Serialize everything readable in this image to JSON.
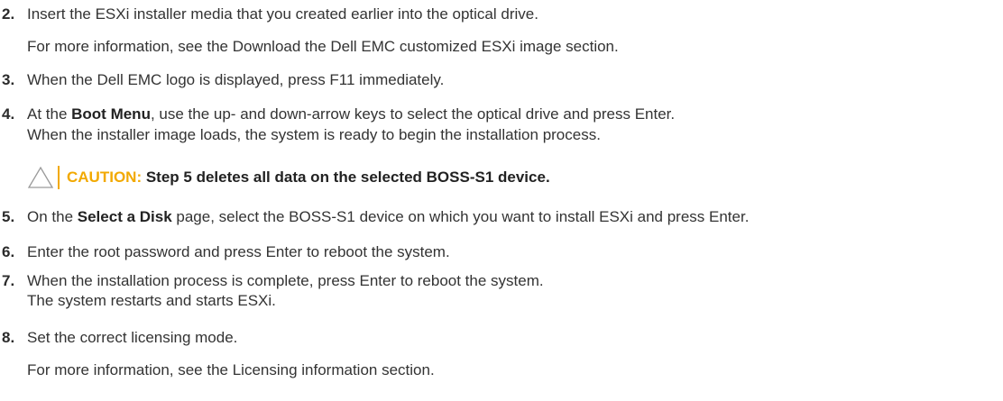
{
  "steps": [
    {
      "number": "2.",
      "lines": [
        "Insert the ESXi installer media that you created earlier into the optical drive.",
        "For more information, see the Download the Dell EMC customized ESXi image section."
      ]
    },
    {
      "number": "3.",
      "lines": [
        "When the Dell EMC logo is displayed, press F11 immediately."
      ]
    },
    {
      "number": "4.",
      "pre": "At the ",
      "bold": "Boot Menu",
      "post": ", use the up- and down-arrow keys to select the optical drive and press Enter.",
      "extra": "When the installer image loads, the system is ready to begin the installation process."
    },
    {
      "number": "5.",
      "pre": "On the ",
      "bold": "Select a Disk",
      "post": " page, select the BOSS-S1 device on which you want to install ESXi and press Enter."
    },
    {
      "number": "6.",
      "lines": [
        "Enter the root password and press Enter to reboot the system."
      ]
    },
    {
      "number": "7.",
      "lines": [
        "When the installation process is complete, press Enter to reboot the system.",
        "The system restarts and starts ESXi."
      ]
    },
    {
      "number": "8.",
      "lines": [
        "Set the correct licensing mode.",
        "For more information, see the Licensing information section."
      ]
    }
  ],
  "caution": {
    "label": "CAUTION: ",
    "text": "Step 5 deletes all data on the selected BOSS-S1 device."
  },
  "colors": {
    "caution": "#f2a900",
    "text": "#333333"
  }
}
